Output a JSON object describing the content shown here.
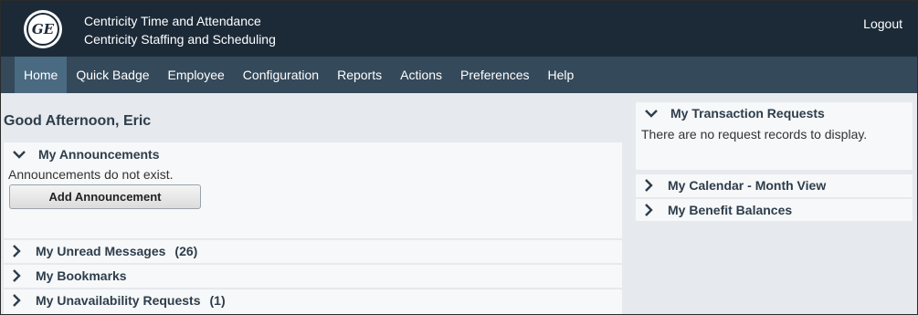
{
  "header": {
    "title_line1": "Centricity Time and Attendance",
    "title_line2": "Centricity Staffing and Scheduling",
    "logout": "Logout",
    "logo_text": "GE"
  },
  "nav": {
    "items": [
      {
        "label": "Home",
        "active": true
      },
      {
        "label": "Quick Badge"
      },
      {
        "label": "Employee"
      },
      {
        "label": "Configuration"
      },
      {
        "label": "Reports"
      },
      {
        "label": "Actions"
      },
      {
        "label": "Preferences"
      },
      {
        "label": "Help"
      }
    ]
  },
  "greeting": "Good Afternoon, Eric",
  "left": {
    "announcements": {
      "title": "My Announcements",
      "empty_text": "Announcements do not exist.",
      "button": "Add Announcement"
    },
    "unread": {
      "title": "My Unread Messages",
      "count": "(26)"
    },
    "bookmarks": {
      "title": "My Bookmarks"
    },
    "unavailability": {
      "title": "My Unavailability Requests",
      "count": "(1)"
    }
  },
  "right": {
    "transactions": {
      "title": "My Transaction Requests",
      "empty_text": "There are no request records to display."
    },
    "calendar": {
      "title": "My Calendar - Month View"
    },
    "benefits": {
      "title": "My Benefit Balances"
    }
  },
  "colors": {
    "header_bg": "#1c2a38",
    "nav_bg": "#34495a",
    "nav_active": "#4a6a82",
    "content_bg": "#e6e9ed",
    "panel_bg": "#f6f8f9",
    "heading_text": "#2e3d4b"
  },
  "icons": {
    "expanded": "chevron-down-icon",
    "collapsed": "chevron-right-icon"
  }
}
